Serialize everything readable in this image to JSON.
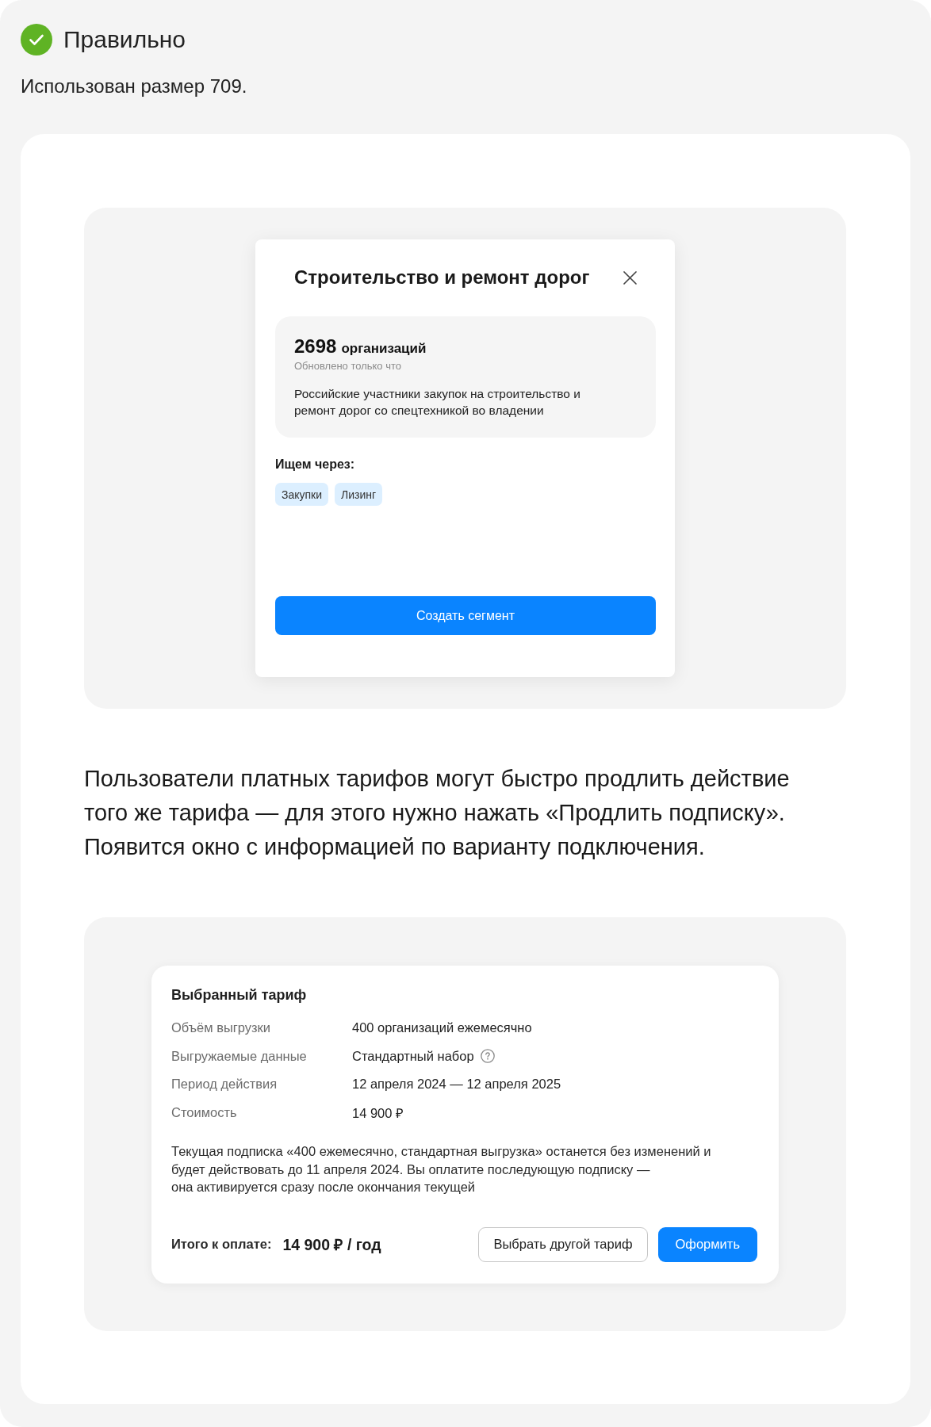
{
  "verdict": {
    "kind": "correct",
    "title": "Правильно",
    "caption": "Использован размер 709."
  },
  "segment_modal": {
    "title": "Строительство и ремонт дорог",
    "summary": {
      "count": "2698",
      "unit": "организаций",
      "updated": "Обновлено только что",
      "description": "Российские участники закупок на строительство и ремонт дорог со спецтехникой во владении"
    },
    "sources_label": "Ищем через:",
    "sources": [
      "Закупки",
      "Лизинг"
    ],
    "button": "Создать сегмент"
  },
  "description": "Пользователи платных тарифов могут быстро продлить действие того же тарифа — для этого нужно нажать «Продлить подписку». Появится окно с информацией по варианту подключения.",
  "tariff_card": {
    "title": "Выбранный тариф",
    "rows": [
      {
        "label": "Объём выгрузки",
        "value": "400 организаций ежемесячно",
        "help": false
      },
      {
        "label": "Выгружаемые данные",
        "value": "Стандартный набор",
        "help": true
      },
      {
        "label": "Период действия",
        "value": "12 апреля 2024 — 12 апреля 2025",
        "help": false
      },
      {
        "label": "Стоимость",
        "value": "14 900 ₽",
        "help": false
      }
    ],
    "note": "Текущая подписка «400 ежемесячно, стандартная выгрузка» останется без изменений и будет действовать до 11 апреля 2024. Вы оплатите последующую подписку —\nона активируется сразу после окончания текущей",
    "total_label": "Итого к оплате:",
    "total_value": "14 900 ₽ / год",
    "buttons": [
      {
        "label": "Выбрать другой тариф",
        "kind": "secondary"
      },
      {
        "label": "Оформить",
        "kind": "primary"
      }
    ]
  }
}
